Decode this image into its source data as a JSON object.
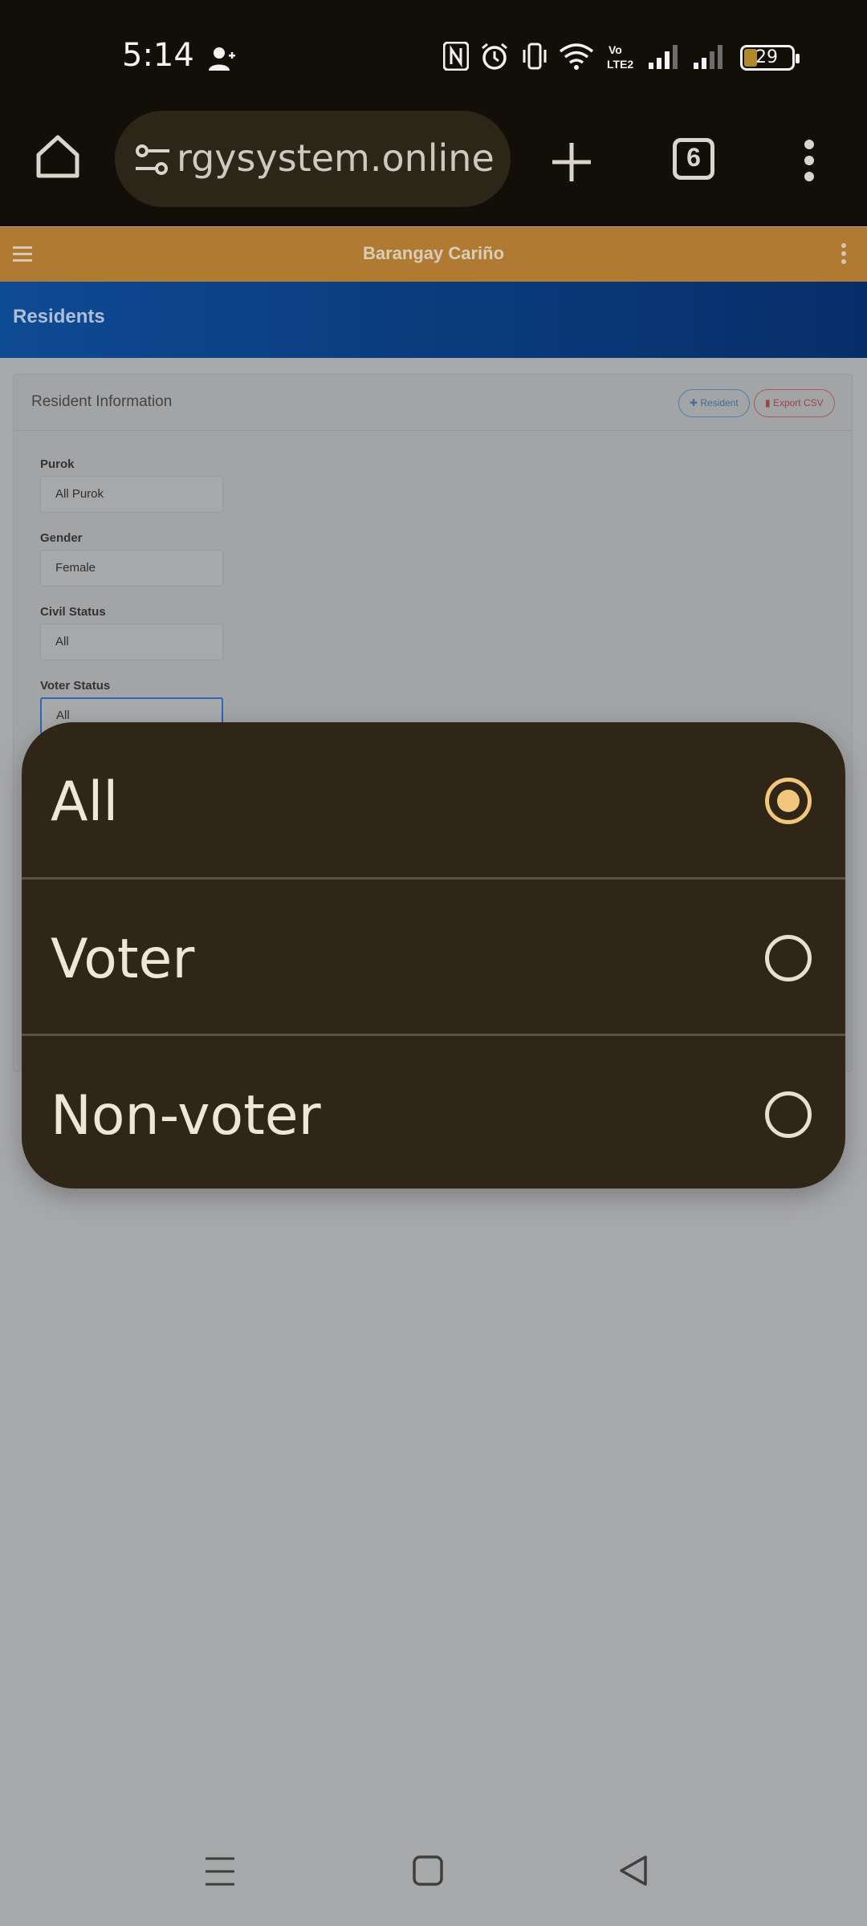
{
  "status_bar": {
    "time": "5:14",
    "battery": "29",
    "icons": [
      "person-add-icon",
      "nfc-icon",
      "alarm-icon",
      "vibrate-icon",
      "wifi-icon",
      "volte-icon",
      "signal-icon",
      "signal-icon",
      "battery-icon"
    ]
  },
  "browser": {
    "url": "rgysystem.online",
    "tab_count": "6"
  },
  "app": {
    "title": "Barangay Cariño",
    "section": "Residents",
    "card_title": "Resident Information",
    "btn_resident": "Resident",
    "btn_export": "Export CSV"
  },
  "filters": [
    {
      "label": "Purok",
      "value": "All Purok"
    },
    {
      "label": "Gender",
      "value": "Female"
    },
    {
      "label": "Civil Status",
      "value": "All"
    },
    {
      "label": "Voter Status",
      "value": "All"
    }
  ],
  "picker": {
    "options": [
      {
        "label": "All",
        "selected": true
      },
      {
        "label": "Voter",
        "selected": false
      },
      {
        "label": "Non-voter",
        "selected": false
      }
    ],
    "accent": "#f3c77a"
  }
}
